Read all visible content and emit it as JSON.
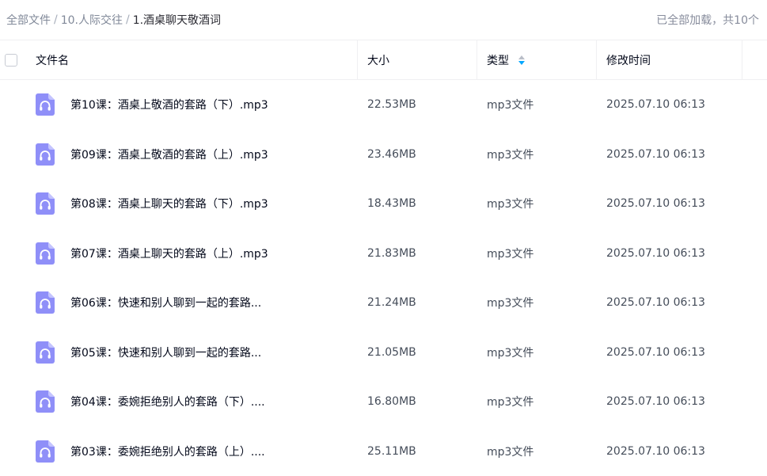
{
  "breadcrumb": {
    "items": [
      "全部文件",
      "10.人际交往"
    ],
    "separator": "/",
    "current": "1.酒桌聊天敬酒词"
  },
  "load_status": "已全部加载，共10个",
  "columns": {
    "name": "文件名",
    "size": "大小",
    "type": "类型",
    "modified": "修改时间"
  },
  "colors": {
    "icon_fill": "#8f8ff8",
    "icon_fold": "#c4c4ff",
    "sort_active": "#06a7ff"
  },
  "files": [
    {
      "icon": "audio-file-icon",
      "name": "第10课：酒桌上敬酒的套路（下）.mp3",
      "size": "22.53MB",
      "type": "mp3文件",
      "modified": "2025.07.10 06:13"
    },
    {
      "icon": "audio-file-icon",
      "name": "第09课：酒桌上敬酒的套路（上）.mp3",
      "size": "23.46MB",
      "type": "mp3文件",
      "modified": "2025.07.10 06:13"
    },
    {
      "icon": "audio-file-icon",
      "name": "第08课：酒桌上聊天的套路（下）.mp3",
      "size": "18.43MB",
      "type": "mp3文件",
      "modified": "2025.07.10 06:13"
    },
    {
      "icon": "audio-file-icon",
      "name": "第07课：酒桌上聊天的套路（上）.mp3",
      "size": "21.83MB",
      "type": "mp3文件",
      "modified": "2025.07.10 06:13"
    },
    {
      "icon": "audio-file-icon",
      "name": "第06课：快速和别人聊到一起的套路...",
      "size": "21.24MB",
      "type": "mp3文件",
      "modified": "2025.07.10 06:13"
    },
    {
      "icon": "audio-file-icon",
      "name": "第05课：快速和别人聊到一起的套路...",
      "size": "21.05MB",
      "type": "mp3文件",
      "modified": "2025.07.10 06:13"
    },
    {
      "icon": "audio-file-icon",
      "name": "第04课：委婉拒绝别人的套路（下）....",
      "size": "16.80MB",
      "type": "mp3文件",
      "modified": "2025.07.10 06:13"
    },
    {
      "icon": "audio-file-icon",
      "name": "第03课：委婉拒绝别人的套路（上）....",
      "size": "25.11MB",
      "type": "mp3文件",
      "modified": "2025.07.10 06:13"
    }
  ]
}
